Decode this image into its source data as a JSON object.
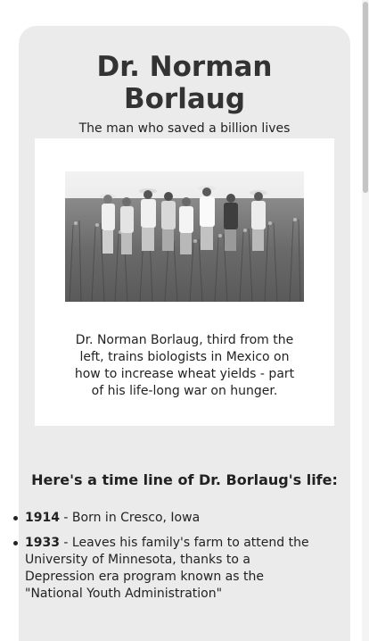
{
  "header": {
    "title_line1": "Dr. Norman",
    "title_line2": "Borlaug",
    "subtitle": "The man who saved a billion lives"
  },
  "photo": {
    "icon": "wheat-field-photo",
    "caption": "Dr. Norman Borlaug, third from the left, trains biologists in Mexico on how to increase wheat yields - part of his life-long war on hunger."
  },
  "timeline": {
    "heading": "Here's a time line of Dr. Borlaug's life:",
    "items": [
      {
        "year": "1914",
        "text": " - Born in Cresco, Iowa"
      },
      {
        "year": "1933",
        "text": " - Leaves his family's farm to attend the University of Minnesota, thanks to a Depression era program known as the \"National Youth Administration\""
      }
    ]
  },
  "colors": {
    "card_bg": "#ebebeb",
    "photo_box_bg": "#ffffff",
    "text": "#222222"
  }
}
